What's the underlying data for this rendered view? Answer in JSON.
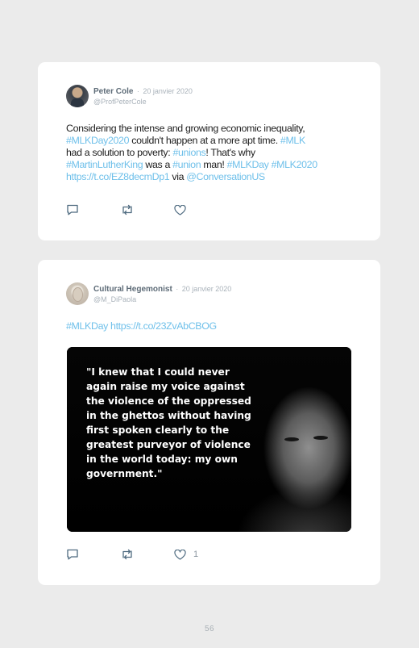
{
  "tweets": [
    {
      "author": "Peter Cole",
      "separator": "·",
      "date": "20 janvier 2020",
      "handle": "@ProfPeterCole",
      "avatar_icon": "profile-photo",
      "text": {
        "t1": "Considering the intense and growing economic inequality, ",
        "l1": "#MLKDay2020",
        "t2": " couldn't happen at a more apt time. ",
        "l2": "#MLK",
        "t3": " had a solution to poverty: ",
        "l3": "#unions",
        "t4": "! That's why ",
        "l4": "#MartinLutherKing",
        "t5": " was a ",
        "l5": "#union",
        "t6": " man! ",
        "l6": "#MLKDay",
        "t7": " ",
        "l7": "#MLK2020",
        "t8": " ",
        "l8": "https://t.co/EZ8decmDp1",
        "t9": " via ",
        "l9": "@ConversationUS"
      },
      "actions": {
        "reply_icon": "reply-icon",
        "retweet_icon": "retweet-icon",
        "like_icon": "heart-icon",
        "like_count": ""
      }
    },
    {
      "author": "Cultural Hegemonist",
      "separator": "·",
      "date": "20 janvier 2020",
      "handle": "@M_DiPaola",
      "avatar_icon": "profile-photo",
      "text": {
        "l1": "#MLKDay",
        "t1": " ",
        "l2": "https://t.co/23ZvAbCBOG"
      },
      "media_quote": "\"I knew that I could never again raise my voice against the violence of the oppressed in the ghettos without having first spoken clearly to the greatest purveyor of violence in the world today: my own government.\"",
      "actions": {
        "reply_icon": "reply-icon",
        "retweet_icon": "retweet-icon",
        "like_icon": "heart-icon",
        "like_count": "1"
      }
    }
  ],
  "page_number": "56",
  "colors": {
    "link": "#6fc0ea",
    "name": "#5d6b77",
    "muted": "#a9b2ba",
    "background": "#ebebeb"
  }
}
